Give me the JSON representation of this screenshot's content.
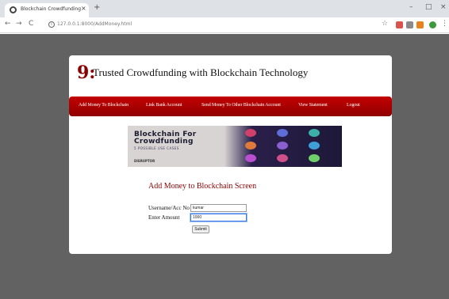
{
  "browser": {
    "tab_title": "Blockchain Crowdfunding",
    "url": "127.0.0.1:8000/AddMoney.html",
    "new_tab_glyph": "+",
    "close_glyph": "×",
    "minimize_glyph": "–",
    "restore_glyph": "□",
    "window_close_glyph": "×",
    "back_glyph": "←",
    "forward_glyph": "→",
    "reload_glyph": "C",
    "star_glyph": "☆",
    "menu_glyph": "⋮",
    "info_glyph": "i"
  },
  "site": {
    "logo_glyph": "9:",
    "title": "Trusted Crowdfunding with Blockchain Technology",
    "accent_color": "#8b0000"
  },
  "menu": [
    {
      "label": "Add Money To Blockchain"
    },
    {
      "label": "Link Bank Account"
    },
    {
      "label": "Send Money To Other Blockchain Account"
    },
    {
      "label": "View Statement"
    },
    {
      "label": "Logout"
    }
  ],
  "banner": {
    "line1": "Blockchain For",
    "line2": "Crowdfunding",
    "subtitle": "5 POSSIBLE USE CASES",
    "brand": "DISRUPTOR"
  },
  "form": {
    "heading": "Add Money to Blockchain Screen",
    "username_label": "Username/Acc No",
    "username_value": "kumar",
    "amount_label": "Enter Amount",
    "amount_value": "1000",
    "submit_label": "Submit"
  }
}
